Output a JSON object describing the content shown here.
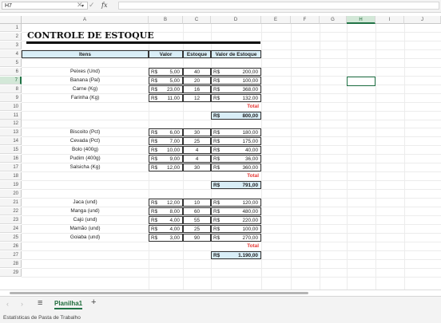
{
  "formula_bar": {
    "name_box": "H7",
    "fx": "fx"
  },
  "columns": [
    "A",
    "B",
    "C",
    "D",
    "E",
    "F",
    "G",
    "H",
    "I",
    "J"
  ],
  "selected_column": "H",
  "rows": [
    "1",
    "2",
    "3",
    "4",
    "5",
    "6",
    "7",
    "8",
    "9",
    "10",
    "11",
    "12",
    "13",
    "14",
    "15",
    "16",
    "17",
    "18",
    "19",
    "20",
    "21",
    "22",
    "23",
    "24",
    "25",
    "26",
    "27",
    "28",
    "29"
  ],
  "sheet": {
    "title": "CONTROLE DE ESTOQUE",
    "headers": {
      "itens": "Itens",
      "valor": "Valor",
      "estoque": "Estoque",
      "valor_estoque": "Valor de Estoque"
    },
    "currency": "R$",
    "total_label": "Total",
    "groups": [
      {
        "items": [
          {
            "name": "Peixes (Und)",
            "price": "5,00",
            "qty": "40",
            "stock": "200,00"
          },
          {
            "name": "Banana (Pal)",
            "price": "5,00",
            "qty": "20",
            "stock": "100,00"
          },
          {
            "name": "Carne (Kg)",
            "price": "23,00",
            "qty": "16",
            "stock": "368,00"
          },
          {
            "name": "Farinha (Kg)",
            "price": "11,00",
            "qty": "12",
            "stock": "132,00"
          }
        ],
        "total": "800,00"
      },
      {
        "items": [
          {
            "name": "Biscoito (Pct)",
            "price": "6,00",
            "qty": "30",
            "stock": "180,00"
          },
          {
            "name": "Cevada (Pct)",
            "price": "7,00",
            "qty": "25",
            "stock": "175,00"
          },
          {
            "name": "Bolo (400g)",
            "price": "10,00",
            "qty": "4",
            "stock": "40,00"
          },
          {
            "name": "Pudim (400g)",
            "price": "9,00",
            "qty": "4",
            "stock": "36,00"
          },
          {
            "name": "Salsicha (Kg)",
            "price": "12,00",
            "qty": "30",
            "stock": "360,00"
          }
        ],
        "total": "791,00"
      },
      {
        "items": [
          {
            "name": "Jaca (und)",
            "price": "12,00",
            "qty": "10",
            "stock": "120,00"
          },
          {
            "name": "Manga (und)",
            "price": "8,00",
            "qty": "60",
            "stock": "480,00"
          },
          {
            "name": "Cajú (und)",
            "price": "4,00",
            "qty": "55",
            "stock": "220,00"
          },
          {
            "name": "Mamão (und)",
            "price": "4,00",
            "qty": "25",
            "stock": "100,00"
          },
          {
            "name": "Goiaba (und)",
            "price": "3,00",
            "qty": "90",
            "stock": "270,00"
          }
        ],
        "total": "1.190,00"
      }
    ]
  },
  "tabs": {
    "active": "Planilha1",
    "add": "+",
    "menu": "≡",
    "prev": "‹",
    "next": "›"
  },
  "status": {
    "text": "Estatísticas de Pasta de Trabalho"
  },
  "colors": {
    "accent": "#217346",
    "header_fill": "#d9eef7",
    "total_red": "#e53935"
  }
}
